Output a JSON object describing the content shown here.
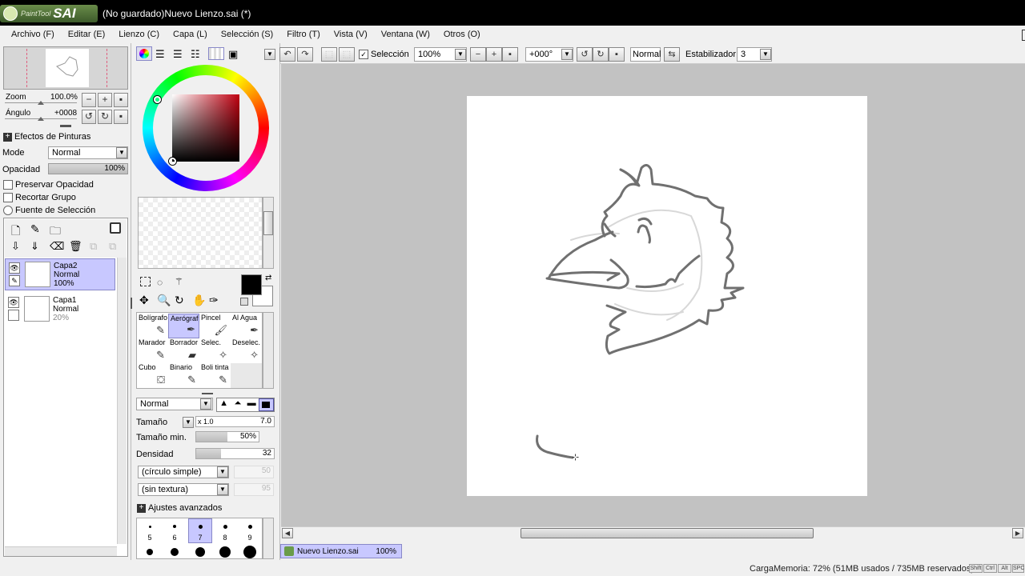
{
  "app": {
    "logo_small": "PaintTool",
    "logo_big": "SAI",
    "title": "(No guardado)Nuevo Lienzo.sai (*)"
  },
  "menu": [
    "Archivo (F)",
    "Editar (E)",
    "Lienzo (C)",
    "Capa (L)",
    "Selección (S)",
    "Filtro (T)",
    "Vista (V)",
    "Ventana (W)",
    "Otros (O)"
  ],
  "navigator": {
    "zoom_label": "Zoom",
    "zoom_value": "100.0%",
    "angle_label": "Ángulo",
    "angle_value": "+0008"
  },
  "layer_props": {
    "effects_label": "Efectos de Pinturas",
    "mode_label": "Mode",
    "mode_value": "Normal",
    "opacity_label": "Opacidad",
    "opacity_value": "100%",
    "opacity_fraction": 1.0,
    "preserve_opacity": "Preservar Opacidad",
    "clip_group": "Recortar Grupo",
    "selection_source": "Fuente de Selección"
  },
  "layers": [
    {
      "name": "Capa2",
      "mode": "Normal",
      "opacity": "100%",
      "selected": true
    },
    {
      "name": "Capa1",
      "mode": "Normal",
      "opacity": "20%",
      "selected": false
    }
  ],
  "tools": [
    {
      "name": "Bolígrafo",
      "icon": "pen-icon",
      "glyph": "✎"
    },
    {
      "name": "Aerógrafo",
      "icon": "airbrush-icon",
      "glyph": "✒",
      "selected": true
    },
    {
      "name": "Pincel",
      "icon": "brush-icon",
      "glyph": "🖌"
    },
    {
      "name": "Al Agua",
      "icon": "watercolor-icon",
      "glyph": "✒"
    },
    {
      "name": "Marador",
      "icon": "marker-icon",
      "glyph": "✎"
    },
    {
      "name": "Borrador",
      "icon": "eraser-icon",
      "glyph": "▰"
    },
    {
      "name": "Selec.",
      "icon": "select-brush-icon",
      "glyph": "✧"
    },
    {
      "name": "Deselec.",
      "icon": "deselect-brush-icon",
      "glyph": "✧"
    },
    {
      "name": "Cubo",
      "icon": "bucket-icon",
      "glyph": "⛋"
    },
    {
      "name": "Binario",
      "icon": "binary-pen-icon",
      "glyph": "✎"
    },
    {
      "name": "Boli tinta",
      "icon": "ink-pen-icon",
      "glyph": "✎"
    }
  ],
  "brush": {
    "blend_mode": "Normal",
    "size_label": "Tamaño",
    "size_mult": "x 1.0",
    "size_value": "7.0",
    "min_size_label": "Tamaño min.",
    "min_size_value": "50%",
    "min_size_fraction": 0.5,
    "density_label": "Densidad",
    "density_value": "32",
    "density_fraction": 0.32,
    "shape": "(círculo simple)",
    "shape_value": "50",
    "texture": "(sin textura)",
    "texture_value": "95",
    "advanced": "Ajustes avanzados"
  },
  "brush_sizes": {
    "labels": [
      "5",
      "6",
      "7",
      "8",
      "9"
    ],
    "selected": "7"
  },
  "toolbar": {
    "selection_label": "Selección",
    "zoom": "100%",
    "angle": "+000°",
    "blend": "Normal",
    "stabilizer_label": "Estabilizador",
    "stabilizer_value": "3"
  },
  "doc_tab": {
    "name": "Nuevo Lienzo.sai",
    "zoom": "100%"
  },
  "status": {
    "memory": "CargaMemoria: 72% (51MB usados / 735MB reservados)",
    "keys": [
      "Shift",
      "Ctrl",
      "Alt",
      "SPC"
    ]
  },
  "colors": {
    "primary": "#000000",
    "secondary": "#ffffff",
    "hue": "#c00010",
    "selection_bg": "#c8c8ff"
  }
}
